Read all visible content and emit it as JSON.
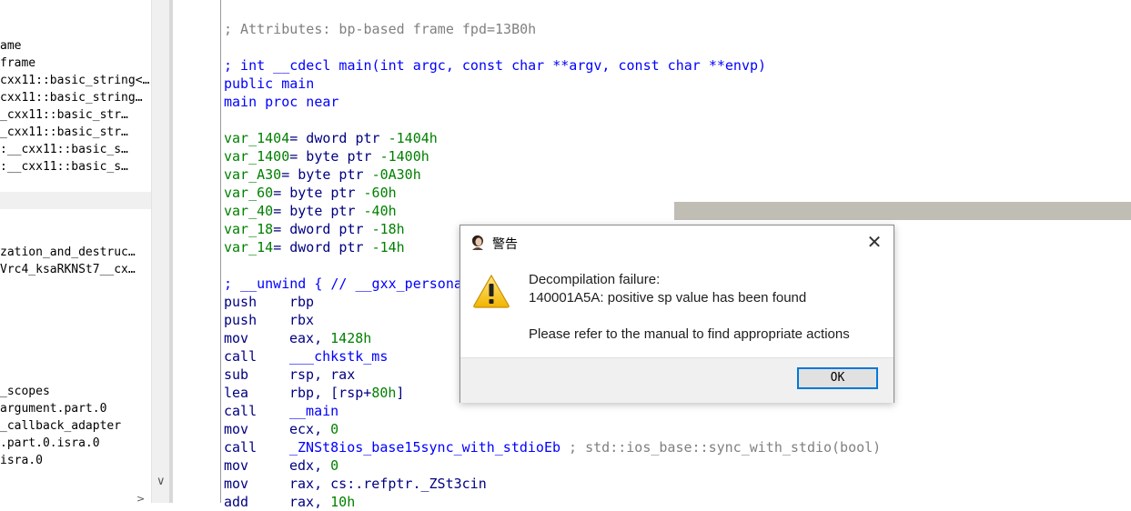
{
  "functions_pane": {
    "items": [
      "ame",
      "frame",
      "cxx11::basic_string<…",
      "cxx11::basic_string…",
      "_cxx11::basic_str…",
      "_cxx11::basic_str…",
      ":__cxx11::basic_s…",
      ":__cxx11::basic_s…",
      "zation_and_destruc…",
      "Vrc4_ksaRKNSt7__cx…",
      "_scopes",
      "argument.part.0",
      "_callback_adapter",
      ".part.0.isra.0",
      "isra.0"
    ],
    "scroll_down_arrow": "∨",
    "bottom_arrow": ">"
  },
  "disassembly": {
    "attributes_comment": "; Attributes: bp-based frame fpd=13B0h",
    "signature_comment": "; int __cdecl main(int argc, const char **argv, const char **envp)",
    "public_line": "public main",
    "proc_line": "main proc near",
    "vars": [
      {
        "name": "var_1404",
        "type": "= dword ptr ",
        "value": "-1404h"
      },
      {
        "name": "var_1400",
        "type": "= byte ptr ",
        "value": "-1400h"
      },
      {
        "name": "var_A30",
        "type": "= byte ptr ",
        "value": "-0A30h"
      },
      {
        "name": "var_60",
        "type": "= byte ptr ",
        "value": "-60h"
      },
      {
        "name": "var_40",
        "type": "= byte ptr ",
        "value": "-40h"
      },
      {
        "name": "var_18",
        "type": "= dword ptr ",
        "value": "-18h"
      },
      {
        "name": "var_14",
        "type": "= dword ptr ",
        "value": "-14h"
      }
    ],
    "unwind_comment": "; __unwind { // __gxx_persona",
    "instructions": [
      {
        "mnemonic": "push",
        "operand": "rbp",
        "num": "",
        "comment": ""
      },
      {
        "mnemonic": "push",
        "operand": "rbx",
        "num": "",
        "comment": ""
      },
      {
        "mnemonic": "mov",
        "operand": "eax, ",
        "num": "1428h",
        "comment": ""
      },
      {
        "mnemonic": "call",
        "operand": "___chkstk_ms",
        "num": "",
        "comment": ""
      },
      {
        "mnemonic": "sub",
        "operand": "rsp, rax",
        "num": "",
        "comment": ""
      },
      {
        "mnemonic": "lea",
        "operand": "rbp, [rsp+",
        "num": "80h",
        "tail": "]",
        "comment": ""
      },
      {
        "mnemonic": "call",
        "operand": "__main",
        "num": "",
        "comment": ""
      },
      {
        "mnemonic": "mov",
        "operand": "ecx, ",
        "num": "0",
        "comment": ""
      },
      {
        "mnemonic": "call",
        "operand": "_ZNSt8ios_base15sync_with_stdioEb",
        "num": "",
        "comment": " ; std::ios_base::sync_with_stdio(bool)"
      },
      {
        "mnemonic": "mov",
        "operand": "edx, ",
        "num": "0",
        "comment": ""
      },
      {
        "mnemonic": "mov",
        "operand": "rax, cs:.refptr._ZSt3cin",
        "num": "",
        "comment": ""
      },
      {
        "mnemonic": "add",
        "operand": "rax, ",
        "num": "10h",
        "comment": ""
      }
    ]
  },
  "dialog": {
    "title": "警告",
    "close_glyph": "✕",
    "message_line1": "Decompilation failure:",
    "message_line2": "140001A5A: positive sp value has been found",
    "message_line3": "Please refer to the manual to find appropriate actions",
    "ok_label": "OK",
    "icon": "warning-icon",
    "accent_color": "#0078d7"
  }
}
